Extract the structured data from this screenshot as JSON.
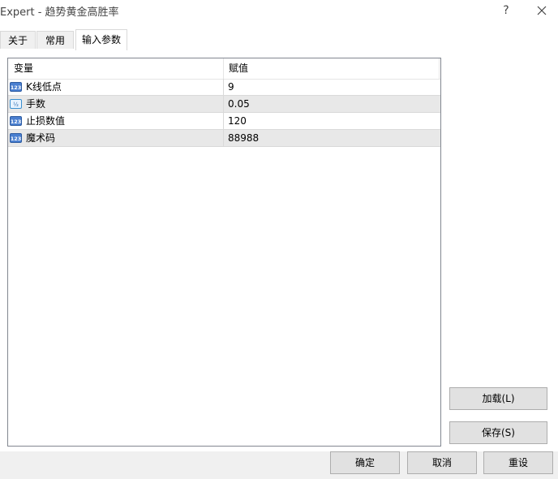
{
  "window": {
    "title": "Expert - 趋势黄金高胜率",
    "help_label": "?"
  },
  "tabs": [
    {
      "label": "关于"
    },
    {
      "label": "常用"
    },
    {
      "label": "输入参数",
      "active": true
    }
  ],
  "table": {
    "headers": {
      "variable": "变量",
      "value": "赋值"
    },
    "rows": [
      {
        "icon": "integer-type-icon",
        "name": "K线低点",
        "value": "9"
      },
      {
        "icon": "double-type-icon",
        "name": "手数",
        "value": "0.05"
      },
      {
        "icon": "integer-type-icon",
        "name": "止损数值",
        "value": "120"
      },
      {
        "icon": "integer-type-icon",
        "name": "魔术码",
        "value": "88988"
      }
    ]
  },
  "side_buttons": {
    "load_label": "加载(L)",
    "save_label": "保存(S)"
  },
  "footer": {
    "ok_label": "确定",
    "cancel_label": "取消",
    "reset_label": "重设"
  },
  "colors": {
    "alt_row": "#e8e8e8",
    "icon_blue": "#3a6fc4"
  }
}
